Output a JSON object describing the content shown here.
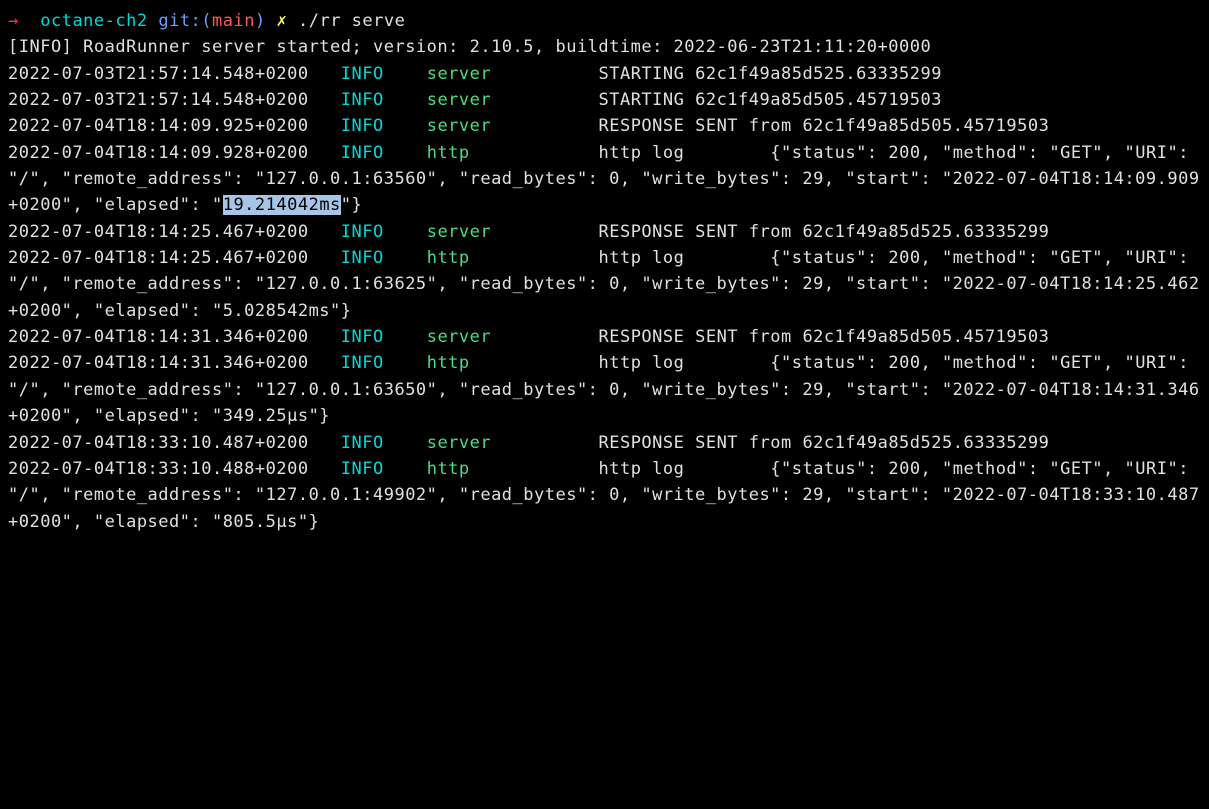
{
  "prompt": {
    "arrow": "→",
    "dir": "octane-ch2",
    "git_label": "git:(",
    "branch": "main",
    "git_close": ")",
    "x": "✗",
    "command": "./rr serve"
  },
  "startup": "[INFO] RoadRunner server started; version: 2.10.5, buildtime: 2022-06-23T21:11:20+0000",
  "logs": [
    {
      "timestamp": "2022-07-03T21:57:14.548+0200",
      "level": "INFO",
      "channel": "server",
      "channel_type": "server",
      "message": "STARTING 62c1f49a85d525.63335299"
    },
    {
      "timestamp": "2022-07-03T21:57:14.548+0200",
      "level": "INFO",
      "channel": "server",
      "channel_type": "server",
      "message": "STARTING 62c1f49a85d505.45719503"
    },
    {
      "timestamp": "2022-07-04T18:14:09.925+0200",
      "level": "INFO",
      "channel": "server",
      "channel_type": "server",
      "message": "RESPONSE SENT from 62c1f49a85d505.45719503"
    },
    {
      "timestamp": "2022-07-04T18:14:09.928+0200",
      "level": "INFO",
      "channel": "http",
      "channel_type": "http",
      "label": "http log",
      "json_prefix": "{\"status\": 200, \"method\": \"GET\", \"URI\": \"/\", \"remote_address\": \"127.0.0.1:63560\", \"read_bytes\": 0, \"write_bytes\": 29, \"start\": \"2022-07-04T18:14:09.909+0200\", \"elapsed\": \"",
      "highlighted": "19.214042ms",
      "json_suffix": "\"}"
    },
    {
      "timestamp": "2022-07-04T18:14:25.467+0200",
      "level": "INFO",
      "channel": "server",
      "channel_type": "server",
      "message": "RESPONSE SENT from 62c1f49a85d525.63335299"
    },
    {
      "timestamp": "2022-07-04T18:14:25.467+0200",
      "level": "INFO",
      "channel": "http",
      "channel_type": "http",
      "label": "http log",
      "json_full": "{\"status\": 200, \"method\": \"GET\", \"URI\": \"/\", \"remote_address\": \"127.0.0.1:63625\", \"read_bytes\": 0, \"write_bytes\": 29, \"start\": \"2022-07-04T18:14:25.462+0200\", \"elapsed\": \"5.028542ms\"}"
    },
    {
      "timestamp": "2022-07-04T18:14:31.346+0200",
      "level": "INFO",
      "channel": "server",
      "channel_type": "server",
      "message": "RESPONSE SENT from 62c1f49a85d505.45719503"
    },
    {
      "timestamp": "2022-07-04T18:14:31.346+0200",
      "level": "INFO",
      "channel": "http",
      "channel_type": "http",
      "label": "http log",
      "json_full": "{\"status\": 200, \"method\": \"GET\", \"URI\": \"/\", \"remote_address\": \"127.0.0.1:63650\", \"read_bytes\": 0, \"write_bytes\": 29, \"start\": \"2022-07-04T18:14:31.346+0200\", \"elapsed\": \"349.25µs\"}"
    },
    {
      "timestamp": "2022-07-04T18:33:10.487+0200",
      "level": "INFO",
      "channel": "server",
      "channel_type": "server",
      "message": "RESPONSE SENT from 62c1f49a85d525.63335299"
    },
    {
      "timestamp": "2022-07-04T18:33:10.488+0200",
      "level": "INFO",
      "channel": "http",
      "channel_type": "http",
      "label": "http log",
      "json_full": "{\"status\": 200, \"method\": \"GET\", \"URI\": \"/\", \"remote_address\": \"127.0.0.1:49902\", \"read_bytes\": 0, \"write_bytes\": 29, \"start\": \"2022-07-04T18:33:10.487+0200\", \"elapsed\": \"805.5µs\"}"
    }
  ]
}
